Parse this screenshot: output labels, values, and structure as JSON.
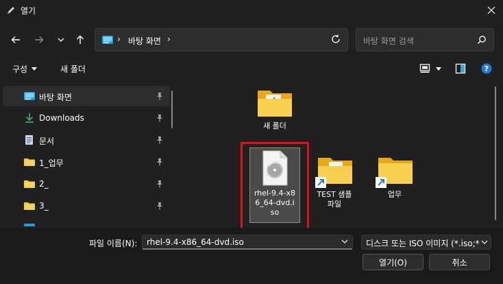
{
  "window": {
    "title": "열기",
    "close_icon": "close-icon"
  },
  "address": {
    "location": "바탕 화면",
    "search_placeholder": "바탕 화면 검색"
  },
  "toolbar": {
    "organize_label": "구성",
    "new_folder_label": "새 폴더"
  },
  "sidebar": {
    "items": [
      {
        "label": "바탕 화면",
        "icon": "desktop-icon"
      },
      {
        "label": "Downloads",
        "icon": "download-icon"
      },
      {
        "label": "문서",
        "icon": "document-icon"
      },
      {
        "label": "1_업무",
        "icon": "folder-icon"
      },
      {
        "label": "2_",
        "icon": "folder-icon"
      },
      {
        "label": "3_",
        "icon": "folder-icon"
      }
    ]
  },
  "files": {
    "new_folder": {
      "label": "새 폴더"
    },
    "iso_file": {
      "line1": "rhel-9.4-x8",
      "line2": "6_64-dvd.i",
      "line3": "so"
    },
    "test_shortcut": {
      "line1": "TEST 샘플",
      "line2": "파일"
    },
    "work_shortcut": {
      "label": "업무"
    }
  },
  "bottom": {
    "filename_label": "파일 이름(N):",
    "filename_value": "rhel-9.4-x86_64-dvd.iso",
    "filetype_value": "디스크 또는 ISO 이미지 (*.iso;*",
    "open_label": "열기(O)",
    "cancel_label": "취소"
  },
  "colors": {
    "background": "#202020",
    "highlight_box": "#e3101b",
    "folder": "#f4c542",
    "help_icon": "#1e7bd6"
  }
}
